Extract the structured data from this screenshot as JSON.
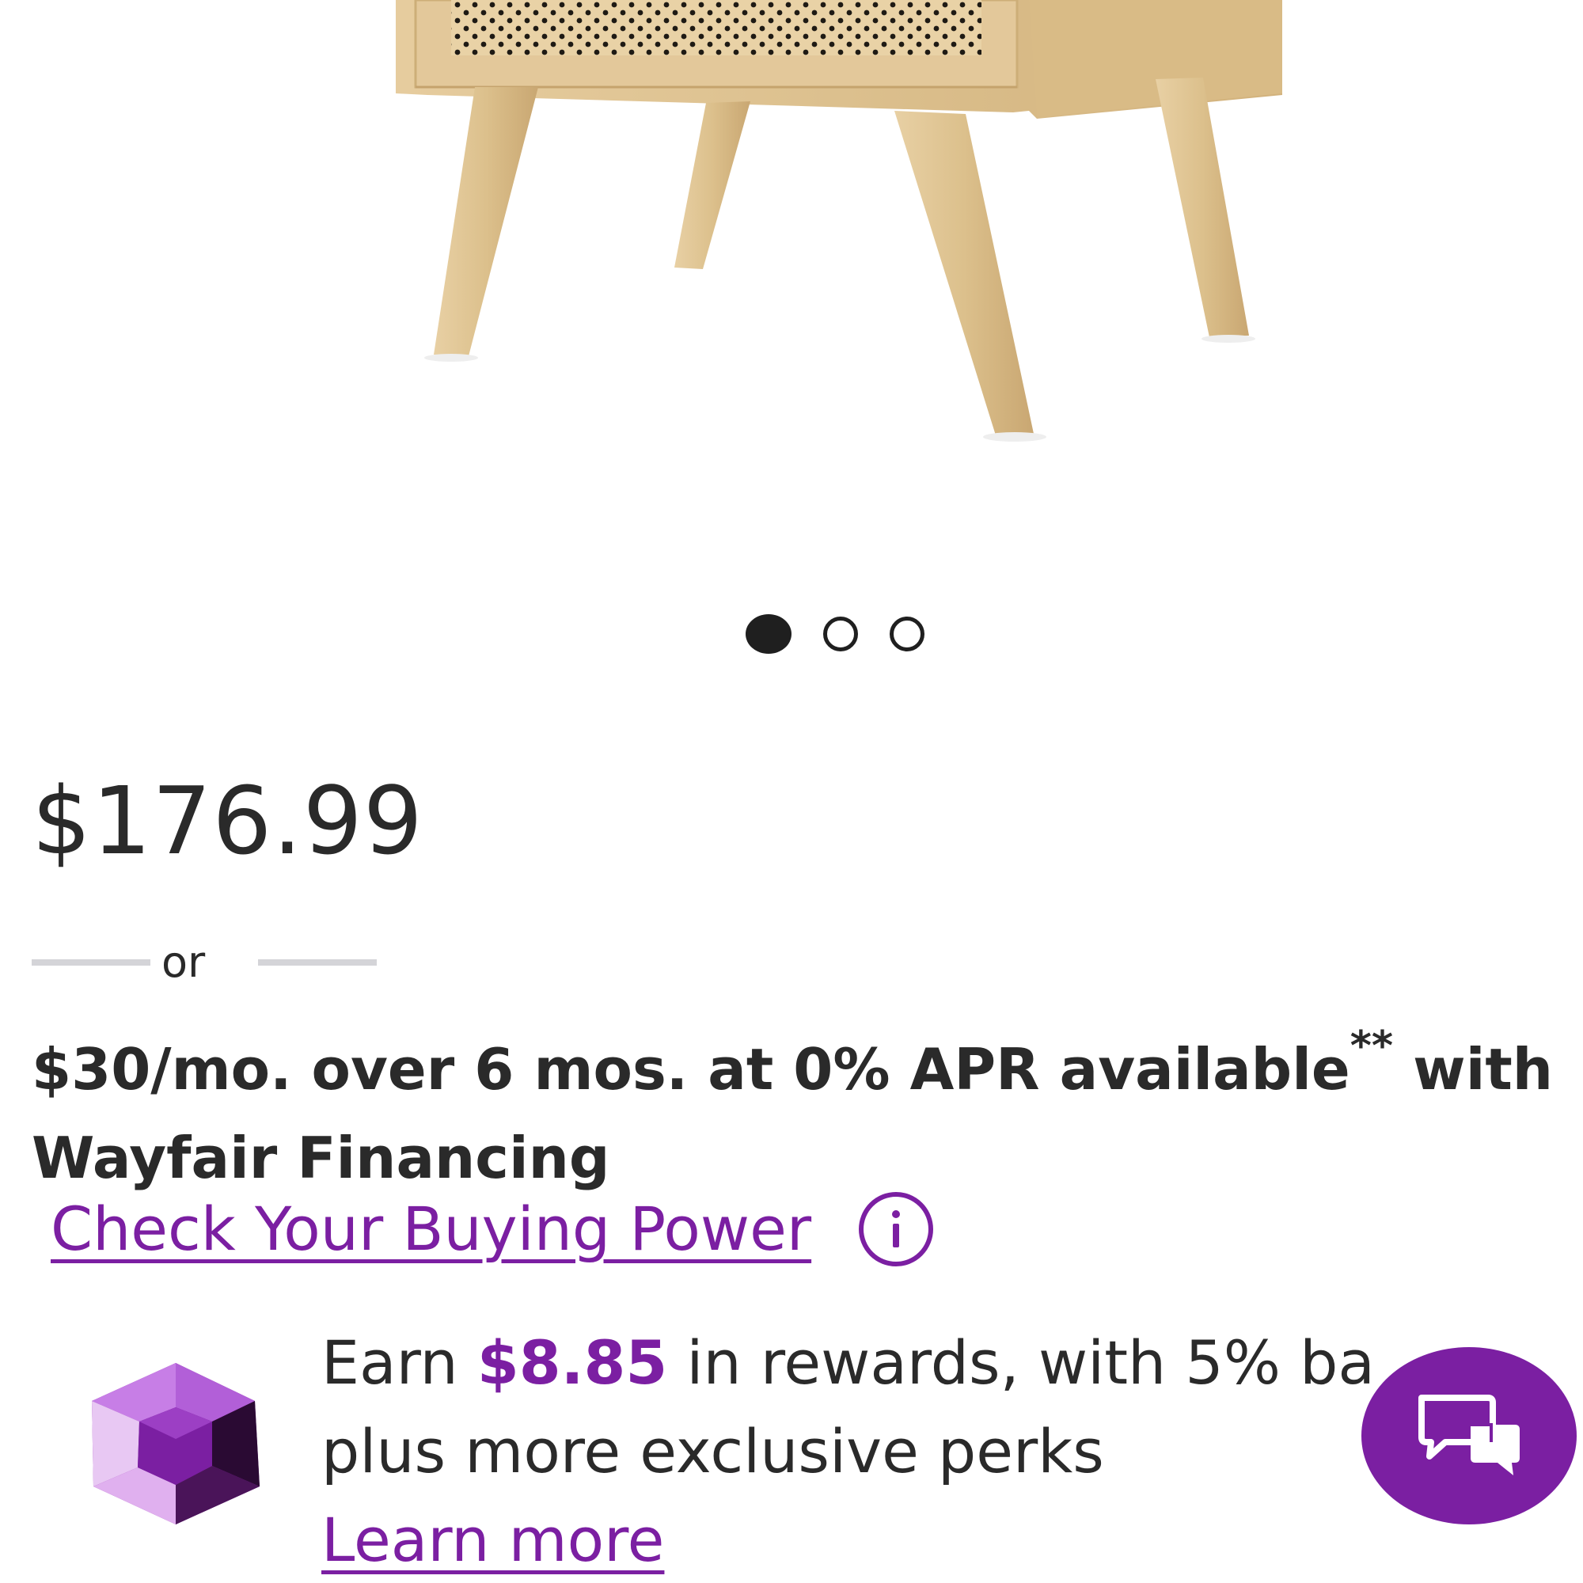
{
  "product": {
    "image_icon": "rattan-nightstand-image"
  },
  "carousel": {
    "dot_count": 3,
    "active_index": 0
  },
  "pricing": {
    "price": "$176.99",
    "or_label": "or",
    "financing_main": "$30/mo. over 6 mos. at 0% APR available",
    "financing_footnote": "**",
    "financing_with": "with",
    "financing_line2": "Wayfair Financing",
    "check_buying_power": "Check Your Buying Power",
    "info_icon": "info-circle-icon"
  },
  "rewards": {
    "icon": "purple-gem-icon",
    "earn_prefix": "Earn ",
    "amount": "$8.85",
    "earn_suffix": " in rewards, with 5% ba",
    "line2": "plus more exclusive perks",
    "learn_more": "Learn more"
  },
  "chat": {
    "icon": "chat-bubbles-icon"
  },
  "colors": {
    "accent_purple": "#7b1fa2",
    "text_dark": "#2a2a2a",
    "divider_gray": "#d4d4d8",
    "wood": "#dcc08f"
  }
}
